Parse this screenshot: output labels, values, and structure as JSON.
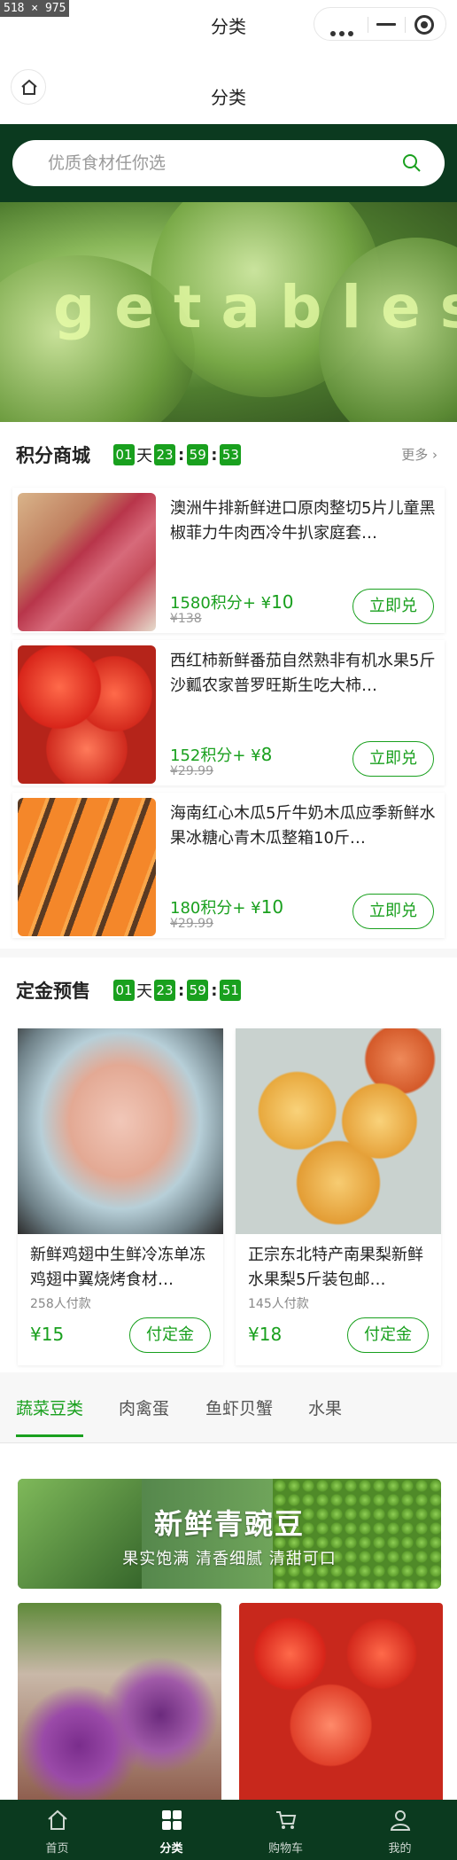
{
  "debug_size": "518 × 975",
  "system_bar": {
    "title": "分类"
  },
  "nav": {
    "title": "分类"
  },
  "search": {
    "placeholder": "优质食材任你选"
  },
  "banner": {
    "word": "getables"
  },
  "points_mall": {
    "title": "积分商城",
    "countdown": {
      "days": "01",
      "day_unit": "天",
      "hours": "23",
      "minutes": "59",
      "seconds": "53"
    },
    "more": "更多",
    "items": [
      {
        "desc": "澳洲牛排新鲜进口原肉整切5片儿童黑椒菲力牛肉西冷牛扒家庭套…",
        "points": "1580积分",
        "plus": "+ ¥",
        "cash": "10",
        "orig": "¥138",
        "btn": "立即兑"
      },
      {
        "desc": "西红柿新鲜番茄自然熟非有机水果5斤沙瓤农家普罗旺斯生吃大柿…",
        "points": "152积分",
        "plus": "+ ¥",
        "cash": "8",
        "orig": "¥29.99",
        "btn": "立即兑"
      },
      {
        "desc": "海南红心木瓜5斤牛奶木瓜应季新鲜水果冰糖心青木瓜整箱10斤…",
        "points": "180积分",
        "plus": "+ ¥",
        "cash": "10",
        "orig": "¥29.99",
        "btn": "立即兑"
      }
    ]
  },
  "presale": {
    "title": "定金预售",
    "countdown": {
      "days": "01",
      "day_unit": "天",
      "hours": "23",
      "minutes": "59",
      "seconds": "51"
    },
    "items": [
      {
        "name": "新鲜鸡翅中生鲜冷冻单冻鸡翅中翼烧烤食材…",
        "sold": "258人付款",
        "price": "¥15",
        "btn": "付定金"
      },
      {
        "name": "正宗东北特产南果梨新鲜水果梨5斤装包邮…",
        "sold": "145人付款",
        "price": "¥18",
        "btn": "付定金"
      }
    ]
  },
  "category_tabs": [
    "蔬菜豆类",
    "肉禽蛋",
    "鱼虾贝蟹",
    "水果"
  ],
  "promo": {
    "title": "新鲜青豌豆",
    "subtitle": "果实饱满  清香细腻  清甜可口"
  },
  "tabbar": [
    "首页",
    "分类",
    "购物车",
    "我的"
  ],
  "colors": {
    "brand_green": "#19a01e",
    "dark_green": "#0b3a1f"
  }
}
